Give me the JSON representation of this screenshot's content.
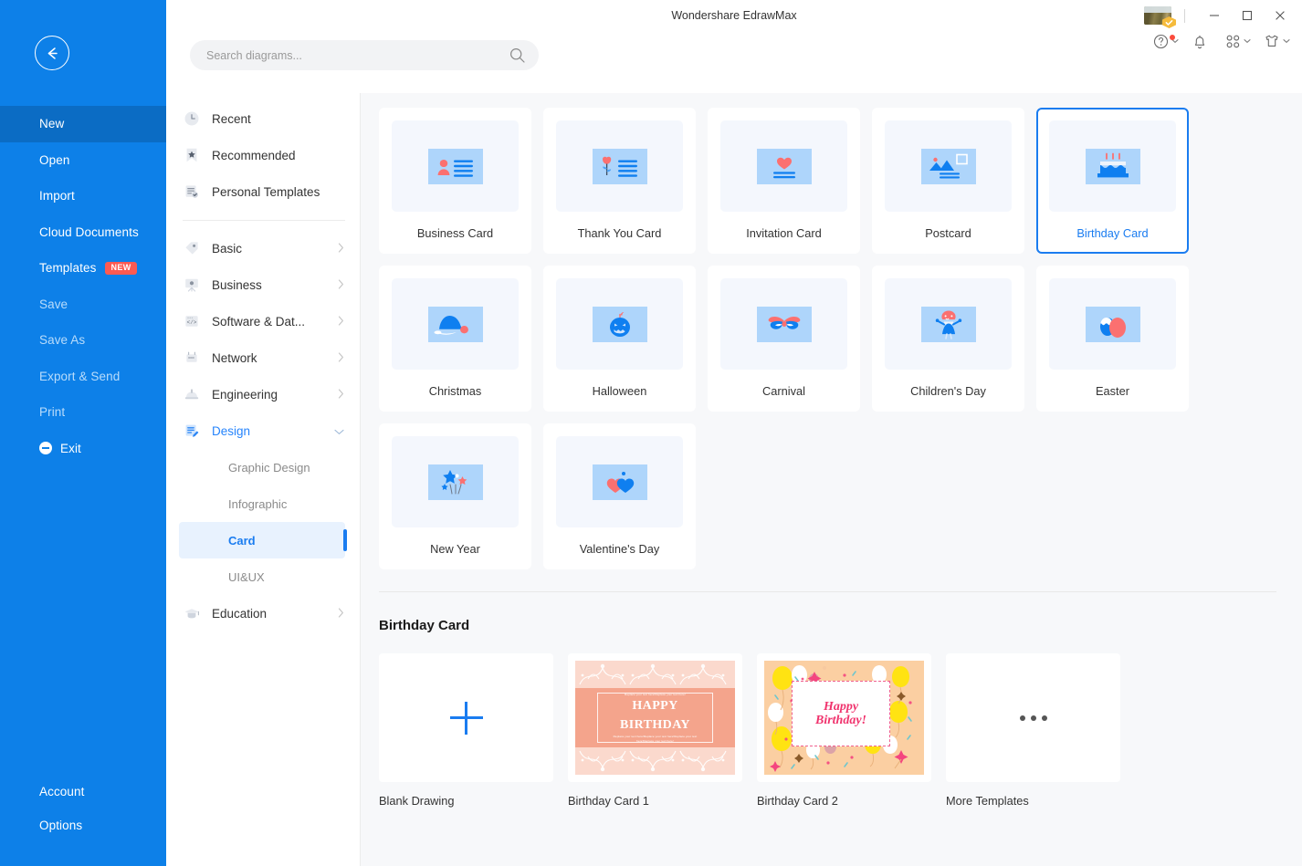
{
  "window": {
    "title": "Wondershare EdrawMax",
    "controls": {
      "minimize": "–",
      "maximize": "□",
      "close": "×"
    }
  },
  "toolbar_icons": [
    {
      "name": "help-icon",
      "label": "Help"
    },
    {
      "name": "bell-icon",
      "label": "Notifications"
    },
    {
      "name": "apps-grid-icon",
      "label": "Apps"
    },
    {
      "name": "skin-icon",
      "label": "Skin"
    }
  ],
  "sidebar": {
    "back_label": "Back",
    "items": [
      {
        "label": "New",
        "state": "active"
      },
      {
        "label": "Open",
        "state": "normal"
      },
      {
        "label": "Import",
        "state": "normal"
      },
      {
        "label": "Cloud Documents",
        "state": "normal"
      },
      {
        "label": "Templates",
        "state": "normal",
        "badge": "NEW"
      },
      {
        "label": "Save",
        "state": "dim"
      },
      {
        "label": "Save As",
        "state": "dim"
      },
      {
        "label": "Export & Send",
        "state": "dim"
      },
      {
        "label": "Print",
        "state": "dim"
      },
      {
        "label": "Exit",
        "state": "normal",
        "icon": "exit-icon"
      }
    ],
    "bottom_items": [
      {
        "label": "Account"
      },
      {
        "label": "Options"
      }
    ]
  },
  "search": {
    "placeholder": "Search diagrams...",
    "value": "",
    "icon": "search-icon"
  },
  "tree": {
    "quick": [
      {
        "label": "Recent",
        "icon": "clock-icon"
      },
      {
        "label": "Recommended",
        "icon": "bookmark-star-icon"
      },
      {
        "label": "Personal Templates",
        "icon": "document-check-icon"
      }
    ],
    "categories": [
      {
        "label": "Basic",
        "icon": "tag-icon",
        "expanded": false
      },
      {
        "label": "Business",
        "icon": "presentation-icon",
        "expanded": false
      },
      {
        "label": "Software & Dat...",
        "icon": "code-icon",
        "expanded": false
      },
      {
        "label": "Network",
        "icon": "server-icon",
        "expanded": false
      },
      {
        "label": "Engineering",
        "icon": "helmet-icon",
        "expanded": false
      },
      {
        "label": "Design",
        "icon": "design-pen-icon",
        "expanded": true,
        "children": [
          {
            "label": "Graphic Design",
            "selected": false
          },
          {
            "label": "Infographic",
            "selected": false
          },
          {
            "label": "Card",
            "selected": true
          },
          {
            "label": "UI&UX",
            "selected": false
          }
        ]
      },
      {
        "label": "Education",
        "icon": "graduation-icon",
        "expanded": false
      }
    ]
  },
  "gallery": {
    "tiles": [
      {
        "label": "Business Card",
        "art": "business-card",
        "selected": false
      },
      {
        "label": "Thank You Card",
        "art": "thank-you-card",
        "selected": false
      },
      {
        "label": "Invitation Card",
        "art": "invitation-card",
        "selected": false
      },
      {
        "label": "Postcard",
        "art": "postcard",
        "selected": false
      },
      {
        "label": "Birthday Card",
        "art": "birthday-card",
        "selected": true
      },
      {
        "label": "Christmas",
        "art": "christmas",
        "selected": false
      },
      {
        "label": "Halloween",
        "art": "halloween",
        "selected": false
      },
      {
        "label": "Carnival",
        "art": "carnival",
        "selected": false
      },
      {
        "label": "Children's Day",
        "art": "childrens-day",
        "selected": false
      },
      {
        "label": "Easter",
        "art": "easter",
        "selected": false
      },
      {
        "label": "New Year",
        "art": "new-year",
        "selected": false
      },
      {
        "label": "Valentine's Day",
        "art": "valentines-day",
        "selected": false
      }
    ],
    "section_title": "Birthday Card",
    "templates": [
      {
        "label": "Blank Drawing",
        "art": "plus"
      },
      {
        "label": "Birthday Card 1",
        "art": "birthday-card-1",
        "card_text": {
          "heading_line1": "HAPPY",
          "heading_line2": "BIRTHDAY",
          "top_note": "Replace your text here!Replace your text here!",
          "bottom_note": "Replace your text here!Replace your text here!Replace your text here!Replace your text here!"
        }
      },
      {
        "label": "Birthday Card 2",
        "art": "birthday-card-2",
        "card_text": {
          "heading_line1": "Happy",
          "heading_line2": "Birthday!"
        }
      },
      {
        "label": "More Templates",
        "art": "ellipsis"
      }
    ]
  },
  "colors": {
    "sidebar_blue": "#0d80e8",
    "sidebar_active": "#0b6cc4",
    "accent_blue": "#1a7cf0",
    "badge_red": "#fc5a52",
    "gallery_bg": "#f7f8fa",
    "thumb_bg": "#f4f7fd",
    "art_blue": "#aed5fb",
    "icon_blue": "#0f7ff0",
    "icon_red": "#fb7070"
  }
}
